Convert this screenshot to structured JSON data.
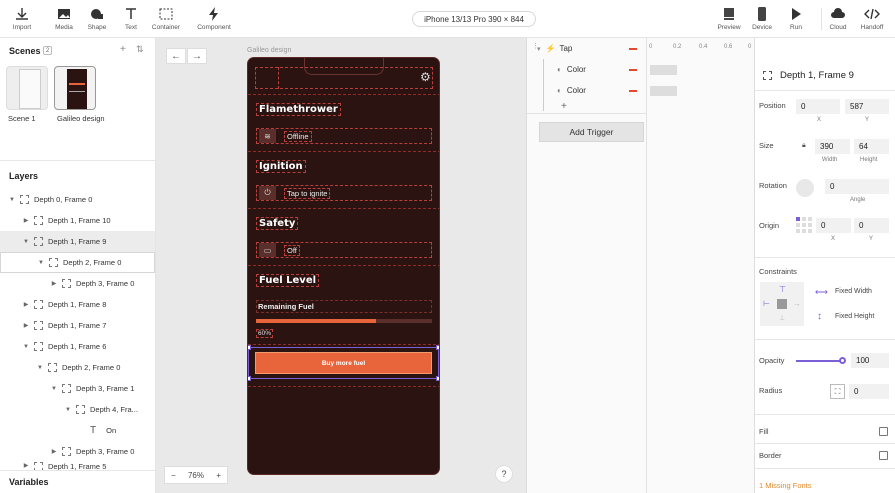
{
  "toolbar": {
    "import": "Import",
    "media": "Media",
    "shape": "Shape",
    "text": "Text",
    "container": "Container",
    "component": "Component",
    "device": "iPhone 13/13 Pro  390 × 844",
    "preview": "Preview",
    "device_btn": "Device",
    "run": "Run",
    "cloud": "Cloud",
    "handoff": "Handoff"
  },
  "scenes": {
    "title": "Scenes",
    "count": "2",
    "items": [
      {
        "label": "Scene 1"
      },
      {
        "label": "Galileo design"
      }
    ]
  },
  "layers": {
    "title": "Layers",
    "items": [
      {
        "label": "Depth 0, Frame 0"
      },
      {
        "label": "Depth 1, Frame 10"
      },
      {
        "label": "Depth 1, Frame 9"
      },
      {
        "label": "Depth 2, Frame 0"
      },
      {
        "label": "Depth 3, Frame 0"
      },
      {
        "label": "Depth 1, Frame 8"
      },
      {
        "label": "Depth 1, Frame 7"
      },
      {
        "label": "Depth 1, Frame 6"
      },
      {
        "label": "Depth 2, Frame 0"
      },
      {
        "label": "Depth 3, Frame 1"
      },
      {
        "label": "Depth 4, Fra..."
      },
      {
        "label": "On"
      },
      {
        "label": "Depth 3, Frame 0"
      },
      {
        "label": "Depth 1, Frame 5"
      }
    ]
  },
  "variables": {
    "title": "Variables"
  },
  "canvas": {
    "frame_label": "Galileo design",
    "zoom": "76%",
    "zoom_minus": "−",
    "zoom_plus": "+",
    "help": "?",
    "back": "←",
    "forward": "→"
  },
  "app": {
    "section1": "Flamethrower",
    "row1": "Offline",
    "section2": "Ignition",
    "row2": "Tap to ignite",
    "section3": "Safety",
    "row3": "Off",
    "section4": "Fuel Level",
    "fuel_label": "Remaining Fuel",
    "fuel_level": 0.68,
    "fuel_pct": "60%",
    "cta": "Buy more fuel"
  },
  "timeline": {
    "trigger": "Tap",
    "row1": "Color",
    "row2": "Color",
    "add": "+",
    "add_trigger": "Add Trigger",
    "ruler": [
      "0",
      "0.2",
      "0.4",
      "0.6",
      "0"
    ]
  },
  "props": {
    "title": "Depth 1, Frame 9",
    "position_label": "Position",
    "pos_x": "0",
    "pos_y": "587",
    "x": "X",
    "y": "Y",
    "size_label": "Size",
    "width": "390",
    "height": "64",
    "w": "Width",
    "h": "Height",
    "rotation_label": "Rotation",
    "angle": "0",
    "angle_label": "Angle",
    "origin_label": "Origin",
    "origin_x": "0",
    "origin_y": "0",
    "constraints_label": "Constraints",
    "fixed_width": "Fixed Width",
    "fixed_height": "Fixed Height",
    "opacity_label": "Opacity",
    "opacity": "100",
    "radius_label": "Radius",
    "radius": "0",
    "fill_label": "Fill",
    "border_label": "Border",
    "missing_fonts": "1 Missing Fonts"
  },
  "colors": {
    "accent": "#e8643a",
    "app_bg": "#2b1311",
    "select": "#7b5fd6",
    "warn": "#e08a2c"
  }
}
